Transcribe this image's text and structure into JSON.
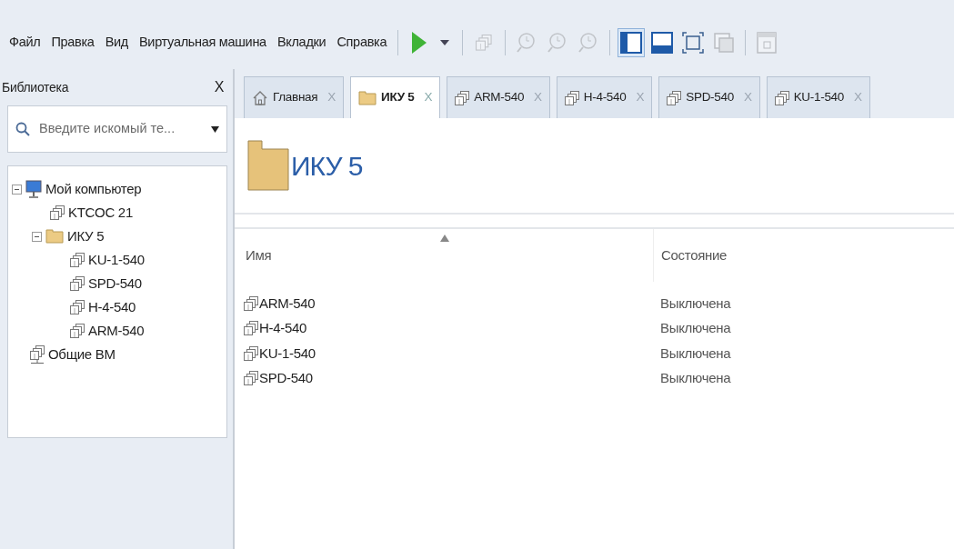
{
  "menu": [
    "Файл",
    "Правка",
    "Вид",
    "Виртуальная машина",
    "Вкладки",
    "Справка"
  ],
  "toolbar": [
    {
      "kind": "play",
      "disabled": false,
      "selected": false
    },
    {
      "kind": "caret",
      "disabled": false,
      "selected": false
    },
    {
      "kind": "sep"
    },
    {
      "kind": "vm",
      "disabled": true,
      "selected": false
    },
    {
      "kind": "sep"
    },
    {
      "kind": "snapshot",
      "disabled": true,
      "selected": false
    },
    {
      "kind": "snapshot",
      "disabled": true,
      "selected": false
    },
    {
      "kind": "snapshot",
      "disabled": true,
      "selected": false
    },
    {
      "kind": "sep"
    },
    {
      "kind": "sidebar",
      "disabled": false,
      "selected": true
    },
    {
      "kind": "panel",
      "disabled": false,
      "selected": false
    },
    {
      "kind": "fullscreen",
      "disabled": false,
      "selected": false
    },
    {
      "kind": "unity",
      "disabled": true,
      "selected": false
    },
    {
      "kind": "sep"
    },
    {
      "kind": "console",
      "disabled": true,
      "selected": false
    }
  ],
  "library": {
    "title": "Библиотека",
    "close": "X",
    "search": {
      "placeholder": "Введите искомый те..."
    },
    "tree": [
      {
        "label": "Мой компьютер",
        "kind": "computer",
        "expanded": true,
        "children": [
          {
            "label": "KTCOC 21",
            "kind": "vm"
          },
          {
            "label": "ИКУ 5",
            "kind": "folder",
            "expanded": true,
            "children": [
              {
                "label": "KU-1-540",
                "kind": "vm"
              },
              {
                "label": "SPD-540",
                "kind": "vm"
              },
              {
                "label": "H-4-540",
                "kind": "vm"
              },
              {
                "label": "ARM-540",
                "kind": "vm"
              }
            ]
          }
        ]
      },
      {
        "label": "Общие ВМ",
        "kind": "shared"
      }
    ]
  },
  "tabs": [
    {
      "label": "Главная",
      "kind": "home",
      "selected": false,
      "close": "X"
    },
    {
      "label": "ИКУ 5",
      "kind": "folder",
      "selected": true,
      "close": "X"
    },
    {
      "label": "ARM-540",
      "kind": "vm",
      "selected": false,
      "close": "X"
    },
    {
      "label": "H-4-540",
      "kind": "vm",
      "selected": false,
      "close": "X"
    },
    {
      "label": "SPD-540",
      "kind": "vm",
      "selected": false,
      "close": "X"
    },
    {
      "label": "KU-1-540",
      "kind": "vm",
      "selected": false,
      "close": "X"
    }
  ],
  "heading": "ИКУ 5",
  "table": {
    "columns": [
      "Имя",
      "Состояние"
    ],
    "rows": [
      {
        "name": "ARM-540",
        "state": "Выключена"
      },
      {
        "name": "H-4-540",
        "state": "Выключена"
      },
      {
        "name": "KU-1-540",
        "state": "Выключена"
      },
      {
        "name": "SPD-540",
        "state": "Выключена"
      }
    ]
  }
}
